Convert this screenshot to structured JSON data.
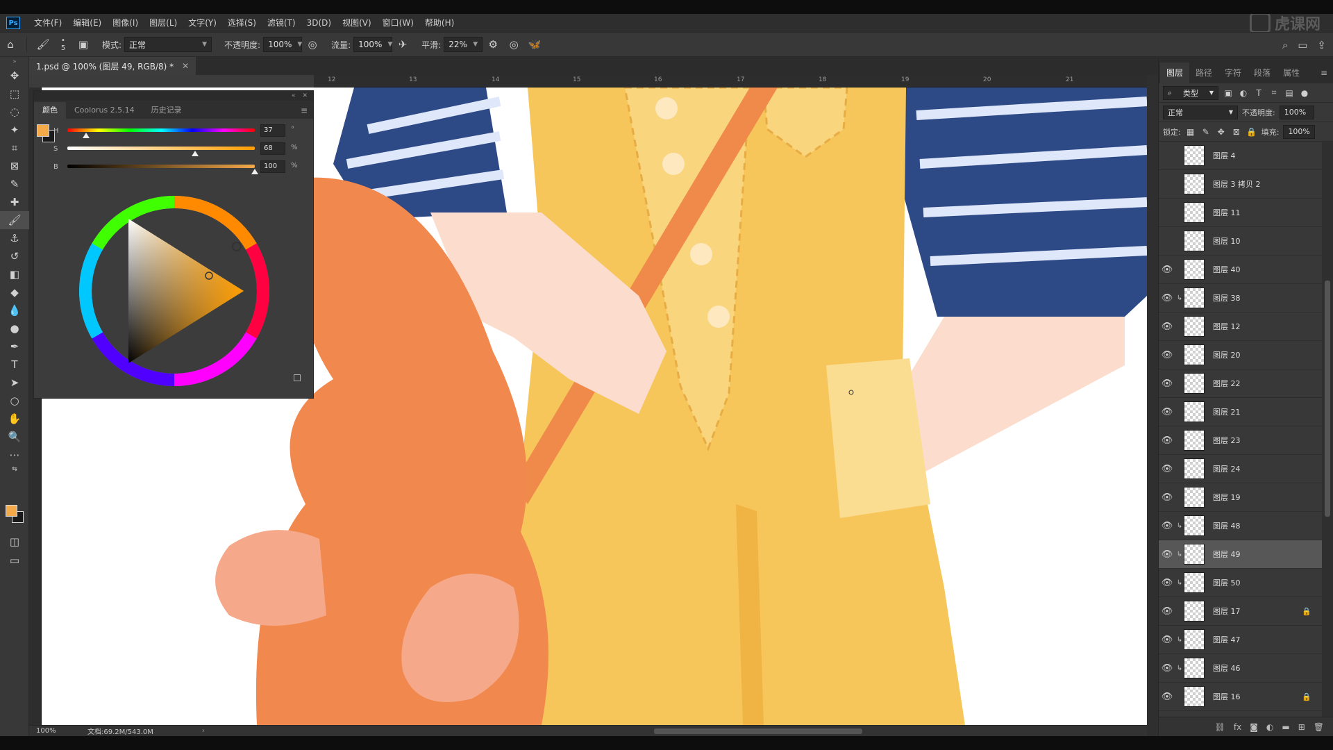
{
  "app": {
    "logo": "Ps",
    "menu": [
      "文件(F)",
      "编辑(E)",
      "图像(I)",
      "图层(L)",
      "文字(Y)",
      "选择(S)",
      "滤镜(T)",
      "3D(D)",
      "视图(V)",
      "窗口(W)",
      "帮助(H)"
    ],
    "watermark": "虎课网"
  },
  "options": {
    "brush_size": "5",
    "mode_label": "模式:",
    "mode_value": "正常",
    "opacity_label": "不透明度:",
    "opacity_value": "100%",
    "flow_label": "流量:",
    "flow_value": "100%",
    "smoothing_label": "平滑:",
    "smoothing_value": "22%"
  },
  "document": {
    "tab_title": "1.psd @ 100% (图层 49, RGB/8) *",
    "ruler_ticks": [
      "12",
      "13",
      "14",
      "15",
      "16",
      "17",
      "18",
      "19",
      "20",
      "21"
    ]
  },
  "color_panel": {
    "tabs": [
      "颜色",
      "Coolorus 2.5.14",
      "历史记录"
    ],
    "h_label": "H",
    "h_value": "37",
    "h_unit": "°",
    "s_label": "S",
    "s_value": "68",
    "s_unit": "%",
    "b_label": "B",
    "b_value": "100",
    "b_unit": "%",
    "h_level": 0.1,
    "s_level": 0.68,
    "b_level": 1.0,
    "foreground": "#f4a94a",
    "background": "#1a1a1a"
  },
  "layers_panel": {
    "tabs": [
      "图层",
      "路径",
      "字符",
      "段落",
      "属性"
    ],
    "filter_kind": "类型",
    "blend_mode": "正常",
    "opacity_label": "不透明度:",
    "opacity_value": "100%",
    "lock_label": "锁定:",
    "fill_label": "填充:",
    "fill_value": "100%",
    "layers": [
      {
        "name": "图层 4",
        "visible": false,
        "clipped": false,
        "locked": false,
        "selected": false
      },
      {
        "name": "图层 3 拷贝 2",
        "visible": false,
        "clipped": false,
        "locked": false,
        "selected": false
      },
      {
        "name": "图层 11",
        "visible": false,
        "clipped": false,
        "locked": false,
        "selected": false
      },
      {
        "name": "图层 10",
        "visible": false,
        "clipped": false,
        "locked": false,
        "selected": false
      },
      {
        "name": "图层 40",
        "visible": true,
        "clipped": false,
        "locked": false,
        "selected": false
      },
      {
        "name": "图层 38",
        "visible": true,
        "clipped": true,
        "locked": false,
        "selected": false
      },
      {
        "name": "图层 12",
        "visible": true,
        "clipped": false,
        "locked": false,
        "selected": false
      },
      {
        "name": "图层 20",
        "visible": true,
        "clipped": false,
        "locked": false,
        "selected": false
      },
      {
        "name": "图层 22",
        "visible": true,
        "clipped": false,
        "locked": false,
        "selected": false
      },
      {
        "name": "图层 21",
        "visible": true,
        "clipped": false,
        "locked": false,
        "selected": false
      },
      {
        "name": "图层 23",
        "visible": true,
        "clipped": false,
        "locked": false,
        "selected": false
      },
      {
        "name": "图层 24",
        "visible": true,
        "clipped": false,
        "locked": false,
        "selected": false
      },
      {
        "name": "图层 19",
        "visible": true,
        "clipped": false,
        "locked": false,
        "selected": false
      },
      {
        "name": "图层 48",
        "visible": true,
        "clipped": true,
        "locked": false,
        "selected": false
      },
      {
        "name": "图层 49",
        "visible": true,
        "clipped": true,
        "locked": false,
        "selected": true
      },
      {
        "name": "图层 50",
        "visible": true,
        "clipped": true,
        "locked": false,
        "selected": false
      },
      {
        "name": "图层 17",
        "visible": true,
        "clipped": false,
        "locked": true,
        "selected": false
      },
      {
        "name": "图层 47",
        "visible": true,
        "clipped": true,
        "locked": false,
        "selected": false
      },
      {
        "name": "图层 46",
        "visible": true,
        "clipped": true,
        "locked": false,
        "selected": false
      },
      {
        "name": "图层 16",
        "visible": true,
        "clipped": false,
        "locked": true,
        "selected": false
      }
    ]
  },
  "status": {
    "zoom": "100%",
    "doc_size": "文档:69.2M/543.0M"
  },
  "colors": {
    "shirt_navy": "#2e4a86",
    "overall_yellow": "#f7c65a",
    "skin": "#fbdccd",
    "strap_orange": "#f08a4b",
    "plush_orange": "#f1894f",
    "plush_light": "#f5a98a"
  }
}
